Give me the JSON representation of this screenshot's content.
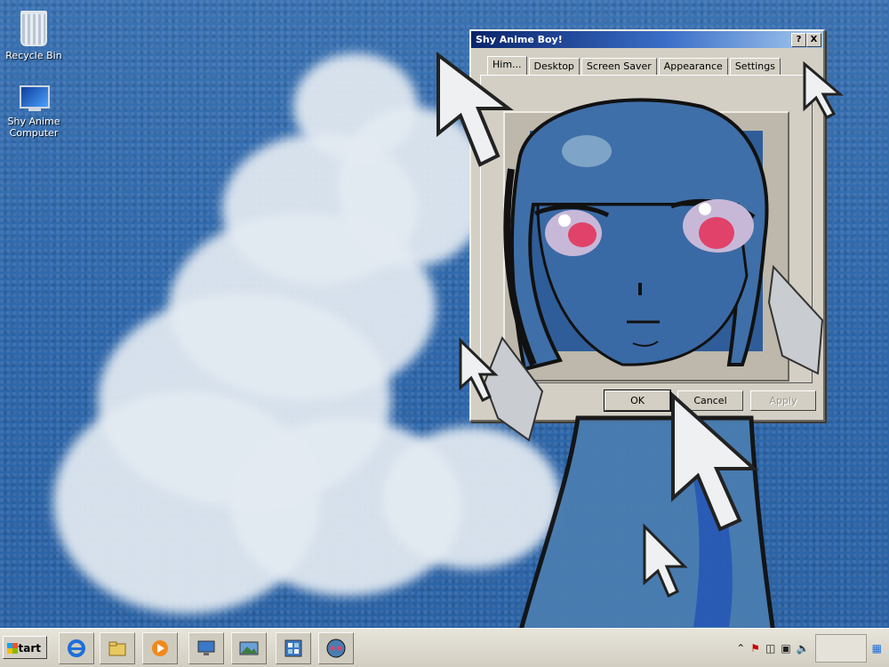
{
  "desktop": {
    "icons": [
      {
        "label": "Recycle Bin",
        "icon": "recycle-bin-icon"
      },
      {
        "label": "Shy Anime Computer",
        "icon": "computer-icon"
      }
    ]
  },
  "dialog": {
    "title": "Shy Anime Boy!",
    "help_button": "?",
    "close_button": "X",
    "tabs": [
      "Him...",
      "Desktop",
      "Screen Saver",
      "Appearance",
      "Settings"
    ],
    "active_tab": "Him...",
    "buttons": {
      "ok": "OK",
      "cancel": "Cancel",
      "apply": "Apply"
    }
  },
  "taskbar": {
    "start_label": "Start",
    "items": [
      "internet-explorer-icon",
      "folder-icon",
      "media-player-icon",
      "monitor-icon",
      "picture-icon",
      "control-panel-icon",
      "anime-face-icon"
    ],
    "tray": [
      "chevron-up-icon",
      "flag-error-icon",
      "device-icon",
      "network-icon",
      "speaker-icon",
      "notification-icon"
    ]
  },
  "colors": {
    "title_start": "#0a246a",
    "title_end": "#a6caf0",
    "desktop": "#2f68ad",
    "dialog_face": "#d3cfc4"
  }
}
